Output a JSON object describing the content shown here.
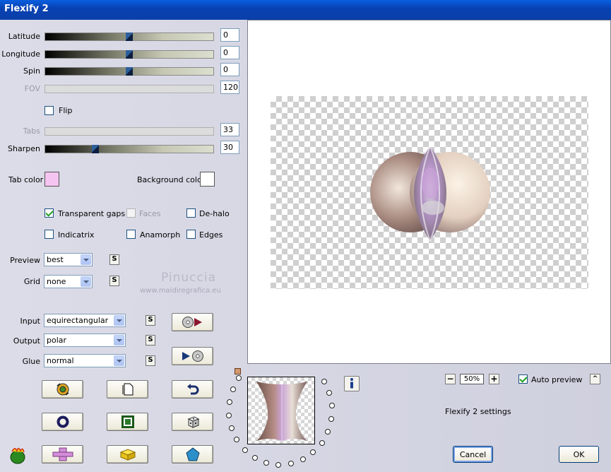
{
  "window": {
    "title": "Flexify 2"
  },
  "sliders": [
    {
      "id": "latitude",
      "label": "Latitude",
      "value": "0",
      "position": 0.5,
      "disabled": false
    },
    {
      "id": "longitude",
      "label": "Longitude",
      "value": "0",
      "position": 0.5,
      "disabled": false
    },
    {
      "id": "spin",
      "label": "Spin",
      "value": "0",
      "position": 0.5,
      "disabled": false
    },
    {
      "id": "fov",
      "label": "FOV",
      "value": "120",
      "position": null,
      "disabled": true
    },
    {
      "id": "tabs",
      "label": "Tabs",
      "value": "33",
      "position": null,
      "disabled": true
    },
    {
      "id": "sharpen",
      "label": "Sharpen",
      "value": "30",
      "position": 0.3,
      "disabled": false
    }
  ],
  "flip": {
    "label": "Flip",
    "checked": false
  },
  "colors": {
    "tab_label": "Tab color",
    "tab": "#f5c4f0",
    "background_label": "Background color",
    "background": "#ffffff",
    "accent": "#0a5fe0"
  },
  "options": {
    "transparent_gaps": {
      "label": "Transparent gaps",
      "checked": true
    },
    "faces": {
      "label": "Faces",
      "checked": false,
      "disabled": true
    },
    "de_halo": {
      "label": "De-halo",
      "checked": false
    },
    "indicatrix": {
      "label": "Indicatrix",
      "checked": false
    },
    "anamorph": {
      "label": "Anamorph",
      "checked": false
    },
    "edges": {
      "label": "Edges",
      "checked": false
    }
  },
  "preview_select": {
    "label": "Preview",
    "value": "best"
  },
  "grid_select": {
    "label": "Grid",
    "value": "none"
  },
  "input_select": {
    "label": "Input",
    "value": "equirectangular"
  },
  "output_select": {
    "label": "Output",
    "value": "polar"
  },
  "glue_select": {
    "label": "Glue",
    "value": "normal"
  },
  "s_button_label": "S",
  "watermark": {
    "name": "Pinuccia",
    "url": "www.maidiregrafica.eu"
  },
  "zoom": {
    "value": "50%",
    "minus": "−",
    "plus": "+"
  },
  "auto_preview": {
    "label": "Auto preview",
    "checked": true
  },
  "up_button": "^",
  "settings_text": "Flexify 2 settings",
  "buttons": {
    "cancel": "Cancel",
    "ok": "OK"
  },
  "icons": {
    "info": "info-icon",
    "tool_row1": [
      "gear-ball-icon",
      "document-icon",
      "undo-arrow-icon"
    ],
    "tool_row2": [
      "ring-icon",
      "square-frame-icon",
      "dice-icon"
    ],
    "tool_row3": [
      "plus-shape-icon",
      "cheese-block-icon",
      "pentagon-icon"
    ],
    "play_in": "disc-to-play-icon",
    "play_out": "play-to-disc-icon",
    "flexify_logo": "flexify-logo-icon"
  }
}
